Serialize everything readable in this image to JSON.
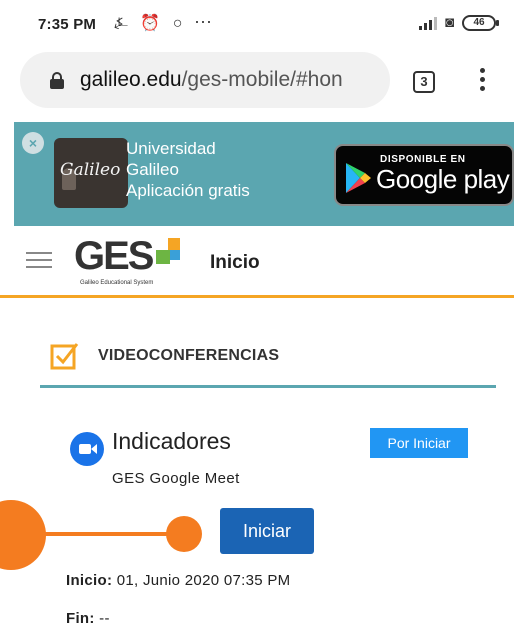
{
  "status_bar": {
    "time": "7:35 PM",
    "left_icons": "⍼ ⏰ ○",
    "more": "···",
    "battery": "46"
  },
  "browser": {
    "url_host": "galileo.edu",
    "url_path": "/ges-mobile/#hon",
    "tabs_count": "3"
  },
  "banner": {
    "app_icon_text": "Galileo",
    "line1": "Universidad",
    "line2": "Galileo",
    "line3": "Aplicación gratis",
    "store_top": "DISPONIBLE EN",
    "store_bottom": "Google play",
    "close": "×",
    "color": "#5ba6b0"
  },
  "header": {
    "logo_text": "GES",
    "logo_sub": "Galileo Educational System",
    "title": "Inicio",
    "underline_color": "#f5a524"
  },
  "section": {
    "title": "VIDEOCONFERENCIAS",
    "icon": "checkbox-icon"
  },
  "card": {
    "title": "Indicadores",
    "subtitle": "GES Google Meet",
    "status": "Por Iniciar",
    "button": "Iniciar",
    "start_label": "Inicio:",
    "start_value": " 01, Junio 2020 07:35 PM",
    "end_label": "Fin:",
    "end_value": " --",
    "accent_color": "#1b64b4",
    "annotation_color": "#f47c20"
  }
}
